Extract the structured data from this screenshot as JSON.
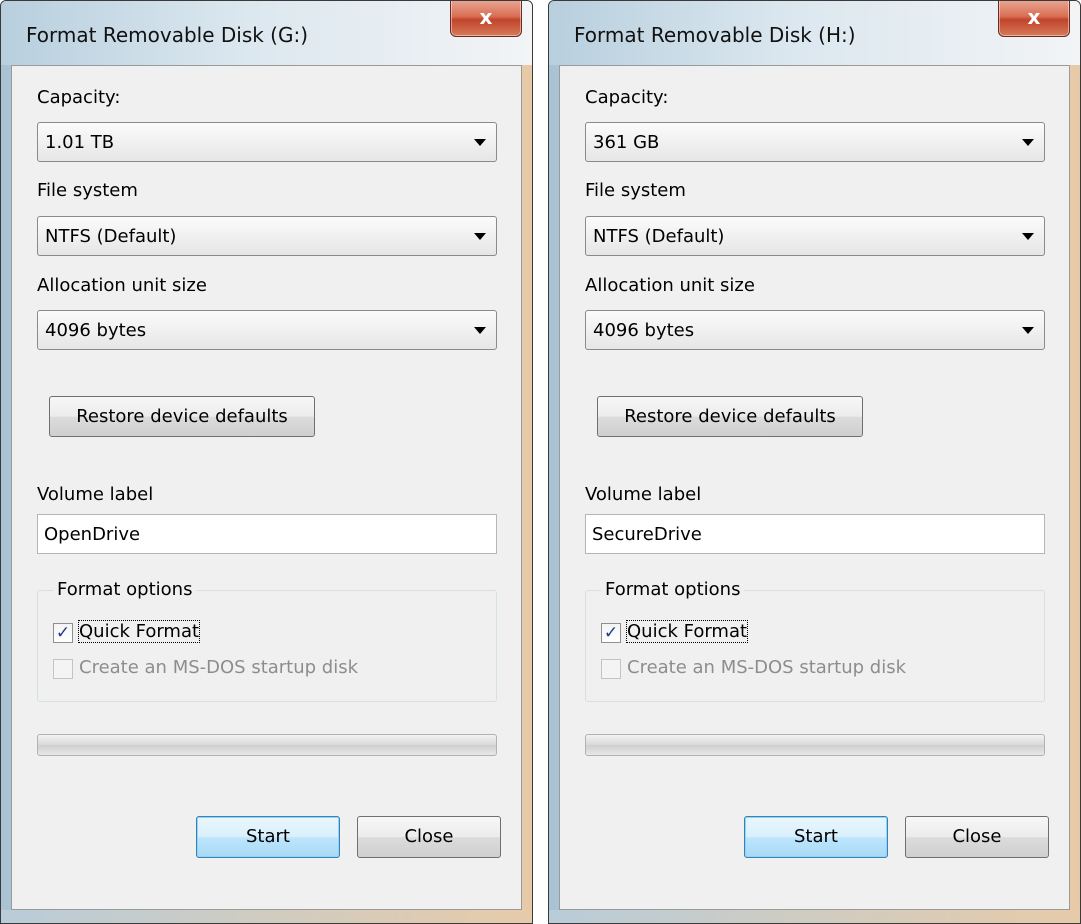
{
  "dialogs": [
    {
      "title": "Format Removable Disk (G:)",
      "close_glyph": "x",
      "capacity_label": "Capacity:",
      "capacity_value": "1.01 TB",
      "filesystem_label": "File system",
      "filesystem_value": "NTFS (Default)",
      "allocation_label": "Allocation unit size",
      "allocation_value": "4096 bytes",
      "restore_button": "Restore device defaults",
      "volume_label_label": "Volume label",
      "volume_label_value": "OpenDrive",
      "format_options_label": "Format options",
      "quick_format_label": "Quick Format",
      "quick_format_checked": true,
      "msdos_label": "Create an MS-DOS startup disk",
      "msdos_checked": false,
      "progress": 0,
      "start_button": "Start",
      "close_button": "Close"
    },
    {
      "title": "Format Removable Disk (H:)",
      "close_glyph": "x",
      "capacity_label": "Capacity:",
      "capacity_value": "361 GB",
      "filesystem_label": "File system",
      "filesystem_value": "NTFS (Default)",
      "allocation_label": "Allocation unit size",
      "allocation_value": "4096 bytes",
      "restore_button": "Restore device defaults",
      "volume_label_label": "Volume label",
      "volume_label_value": "SecureDrive",
      "format_options_label": "Format options",
      "quick_format_label": "Quick Format",
      "quick_format_checked": true,
      "msdos_label": "Create an MS-DOS startup disk",
      "msdos_checked": false,
      "progress": 0,
      "start_button": "Start",
      "close_button": "Close"
    }
  ],
  "icons": {
    "checkmark": "check-icon",
    "dropdown": "chevron-down-icon",
    "close": "close-icon"
  },
  "colors": {
    "primary_button_border": "#3c7fb1",
    "close_button_red": "#c0452b"
  }
}
